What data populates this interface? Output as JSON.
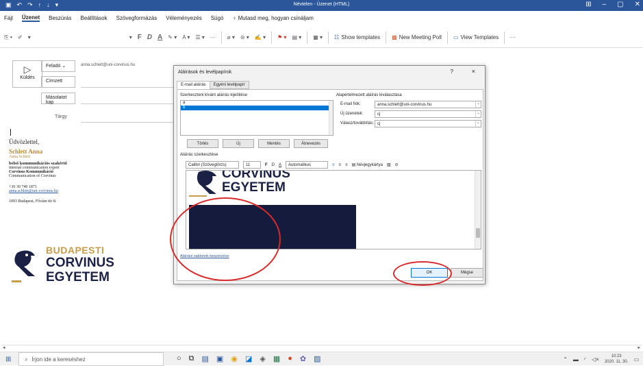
{
  "titlebar": {
    "title": "Névtelen - Üzenet (HTML)"
  },
  "menu": [
    "Fájl",
    "Üzenet",
    "Beszúrás",
    "Beállítások",
    "Szövegformázás",
    "Véleményezés",
    "Súgó"
  ],
  "menu_active": "Üzenet",
  "tell_me": "Mutasd meg, hogyan csináljam",
  "ribbon": {
    "show_templates": "Show templates",
    "new_meeting_poll": "New Meeting Poll",
    "view_templates": "View Templates",
    "more": "···"
  },
  "compose": {
    "send": "Küldés",
    "from_btn": "Feladó",
    "from_value": "anna.schlett@uni-corvinus.hu",
    "to_btn": "Címzett",
    "cc_btn": "Másolatot kap",
    "subject_label": "Tárgy"
  },
  "signature": {
    "greeting": "Üdvözlettel,",
    "name": "Schlett Anna",
    "name_small": "Anna Schlett",
    "role_hu": "belső kommunikációs szakértő",
    "role_en": "internal communication expert",
    "unit_hu": "Corvinus Kommunikáció",
    "unit_en": "Communication of Corvinus",
    "phone": "+36 30 740 1871",
    "email": "anna.schlett@uni-corvinus.hu",
    "address": "1093 Budapest, Fővám tér 8."
  },
  "logo": {
    "line1": "BUDAPESTI",
    "line2": "CORVINUS",
    "line3": "EGYETEM"
  },
  "dialog": {
    "title": "Aláírások és levélpapírok",
    "help": "?",
    "close": "×",
    "tabs": [
      "E-mail aláírás",
      "Egyéni levélpapír"
    ],
    "select_label": "Szerkeszteni kívánt aláírás kijelölése",
    "signatures": [
      "a",
      "b"
    ],
    "selected_index": 1,
    "buttons": [
      "Törlés",
      "Új",
      "Mentés",
      "Átnevezés"
    ],
    "defaults_label": "Alapértelmezett aláírás kiválasztása",
    "email_account_label": "E-mail fiók:",
    "email_account_value": "anna.schlett@uni-corvinus.hu",
    "new_msg_label": "Új üzenetek:",
    "new_msg_value": "cj",
    "reply_label": "Válasz/továbbítás:",
    "reply_value": "cj",
    "edit_label": "Aláírás szerkesztése",
    "font": "Calibri (Szövegtörzs)",
    "size": "11",
    "color": "Automatikus",
    "business_card": "Névjegykártya",
    "editor_line1": "CORVINUS",
    "editor_line2": "EGYETEM",
    "template_link": "Aláírási sablonok beszerzése",
    "ok": "OK",
    "cancel": "Mégse"
  },
  "taskbar": {
    "search_placeholder": "Írjon ide a kereséshez",
    "time": "10:23",
    "date": "2020. 11. 30."
  },
  "colors": {
    "accent": "#2b579a",
    "gold": "#c79d4a",
    "navy": "#1b2144",
    "annotation": "#d92b2b"
  }
}
